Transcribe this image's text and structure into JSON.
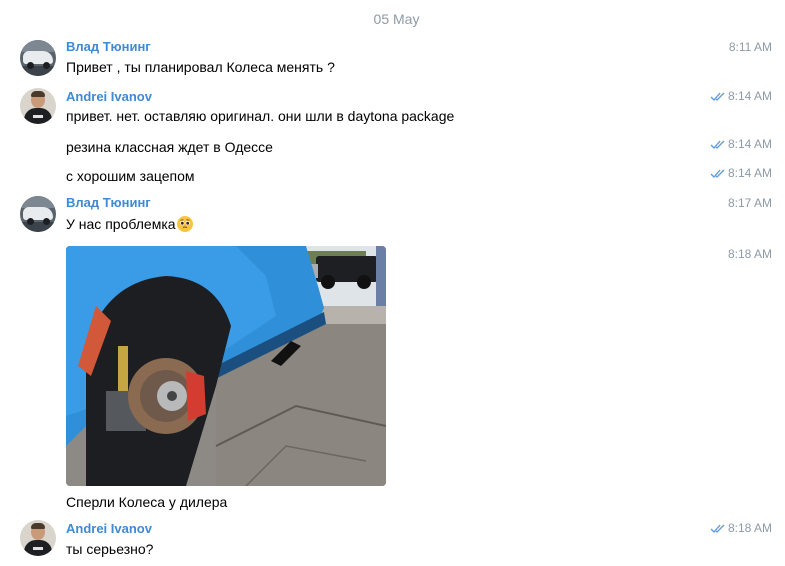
{
  "date_separator": "05 May",
  "messages": [
    {
      "author": "Влад Тюнинг",
      "text": "Привет , ты планировал Колеса менять ?",
      "time": "8:11 AM"
    },
    {
      "author": "Andrei Ivanov",
      "text": "привет. нет. оставляю оригинал. они шли в daytona package",
      "time": "8:14 AM",
      "read": true
    },
    {
      "text": "резина классная ждет в Одессе",
      "time": "8:14 AM",
      "read": true
    },
    {
      "text": "с хорошим зацепом",
      "time": "8:14 AM",
      "read": true
    },
    {
      "author": "Влад Тюнинг",
      "text": "У нас проблемка",
      "emoji": "pleading-face",
      "time": "8:17 AM"
    },
    {
      "photo": "photo-car-without-wheel",
      "caption": "Сперли Колеса у дилера",
      "time": "8:18 AM"
    },
    {
      "author": "Andrei Ivanov",
      "text": "ты серьезно?",
      "time": "8:18 AM",
      "read": true
    }
  ],
  "colors": {
    "author_name": "#3e8ad3",
    "meta_text": "#8e9aa6",
    "read_check": "#5b9ad9"
  },
  "icons": {
    "read_receipt": "double-check-icon"
  }
}
